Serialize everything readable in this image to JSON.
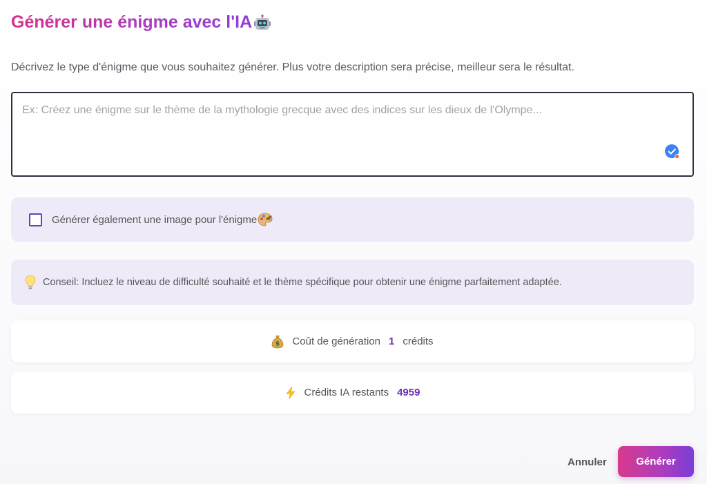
{
  "dialog": {
    "title": "Générer une énigme avec l'IA",
    "title_icon": "robot-icon",
    "description": "Décrivez le type d'énigme que vous souhaitez générer. Plus votre description sera précise, meilleur sera le résultat."
  },
  "prompt": {
    "value": "",
    "placeholder": "Ex: Créez une énigme sur le thème de la mythologie grecque avec des indices sur les dieux de l'Olympe..."
  },
  "image_option": {
    "label": "Générer également une image pour l'énigme",
    "checked": false,
    "icon": "palette-icon"
  },
  "tip": {
    "icon": "lightbulb-icon",
    "text": "Conseil: Incluez le niveau de difficulté souhaité et le thème spécifique pour obtenir une énigme parfaitement adaptée."
  },
  "cost": {
    "icon": "money-bag-icon",
    "label": "Coût de génération",
    "value": "1",
    "suffix": "crédits"
  },
  "remaining": {
    "icon": "lightning-icon",
    "label": "Crédits IA restants",
    "value": "4959"
  },
  "actions": {
    "cancel_label": "Annuler",
    "submit_label": "Générer"
  },
  "colors": {
    "accent_start": "#d6308a",
    "accent_end": "#7a3ed6",
    "panel_tint": "#efeaf7",
    "credit_value": "#6b2fb3"
  }
}
